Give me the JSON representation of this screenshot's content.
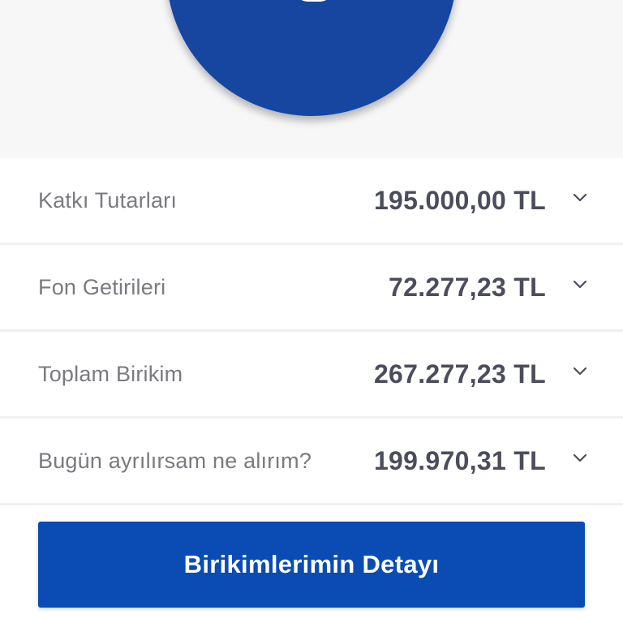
{
  "summary_rows": [
    {
      "label": "Katkı Tutarları",
      "value": "195.000,00 TL",
      "icon": "chevron-down-icon"
    },
    {
      "label": "Fon Getirileri",
      "value": "72.277,23 TL",
      "icon": "chevron-down-icon"
    },
    {
      "label": "Toplam Birikim",
      "value": "267.277,23 TL",
      "icon": "chevron-down-icon"
    },
    {
      "label": "Bugün ayrılırsam ne alırım?",
      "value": "199.970,31 TL",
      "icon": "chevron-down-icon"
    }
  ],
  "cta": {
    "label": "Birikimlerimin Detayı"
  },
  "colors": {
    "brand_blue": "#1746a0",
    "button_blue": "#0a4cb4",
    "value_text": "#4b4d5c",
    "label_text": "#7a7a80"
  }
}
